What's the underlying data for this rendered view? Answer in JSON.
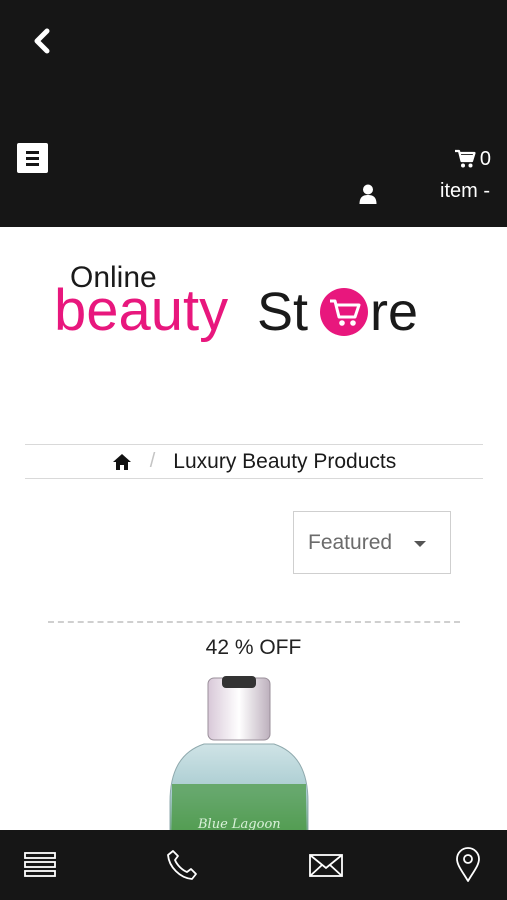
{
  "header": {
    "cart_count": "0",
    "item_label": "item -"
  },
  "logo": {
    "line1": "Online",
    "line2_colored": "beauty",
    "line2_dark_a": "St",
    "line2_dark_b": "re",
    "brand_pink": "#e8177d",
    "brand_dark": "#1a1a1a"
  },
  "breadcrumb": {
    "home_icon": "home-icon",
    "separator": "/",
    "current": "Luxury Beauty Products"
  },
  "sort": {
    "selected": "Featured"
  },
  "product": {
    "discount": "42 % OFF",
    "image_text": "Blue Lagoon"
  },
  "bottom_nav": {
    "icons": [
      "menu-icon",
      "phone-icon",
      "mail-icon",
      "location-pin-icon"
    ]
  },
  "colors": {
    "bar_background": "#161616",
    "accent_pink": "#e8177d"
  }
}
